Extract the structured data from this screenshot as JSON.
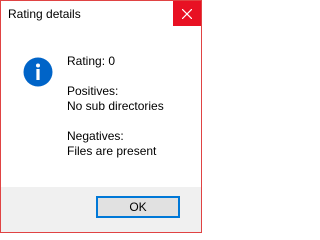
{
  "window": {
    "title": "Rating details",
    "accent_color": "#e81123",
    "border_color": "#e04343"
  },
  "icon": {
    "name": "info-icon",
    "color": "#0064c8"
  },
  "message": {
    "rating": "Rating: 0",
    "positives_heading": "Positives:",
    "positives_value": "No sub directories",
    "negatives_heading": "Negatives:",
    "negatives_value": "Files are present"
  },
  "footer": {
    "ok_label": "OK"
  }
}
